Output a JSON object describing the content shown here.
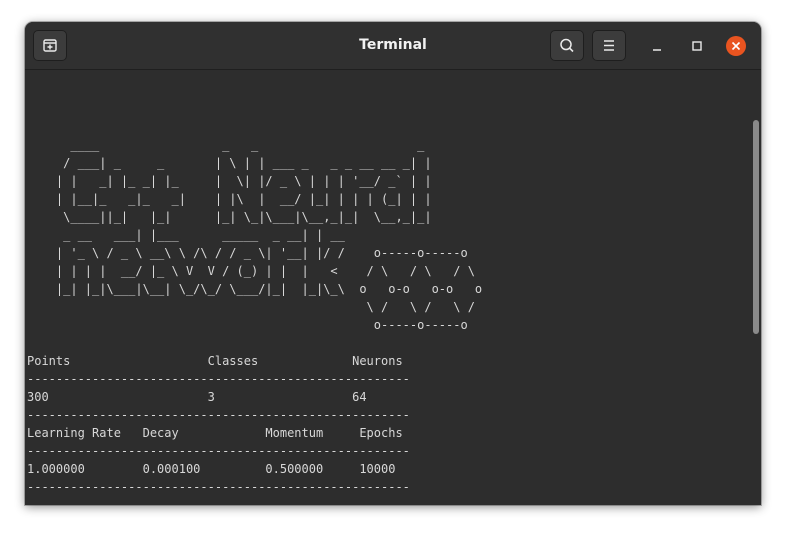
{
  "window": {
    "title": "Terminal",
    "accent_close": "#e95420",
    "background": "#2d2d2d"
  },
  "toolbar": {
    "new_tab_icon": "new-tab-icon",
    "search_icon": "search-icon",
    "menu_icon": "hamburger-menu-icon",
    "minimize_icon": "minimize-icon",
    "maximize_icon": "maximize-icon",
    "close_icon": "close-icon"
  },
  "terminal": {
    "banner": [
      "                                                        ",
      "                                                        ",
      "                                                        ",
      "      ____                 _   _                      _ ",
      "     / ___| _     _       | \\ | | ___ _   _ _ __ __ _| |",
      "    | |   _| |_ _| |_     |  \\| |/ _ \\ | | | '__/ _` | |",
      "    | |__|_   _|_   _|    | |\\  |  __/ |_| | | | (_| | |",
      "     \\____||_|   |_|      |_| \\_|\\___|\\__,_|_|  \\__,_|_|",
      "     _ __   ___| |___      _____  _ __| | __",
      "    | '_ \\ / _ \\ __\\ \\ /\\ / / _ \\| '__| |/ /    o-----o-----o",
      "    | | | |  __/ |_ \\ V  V / (_) | |  |   <    / \\   / \\   / \\",
      "    |_| |_|\\___|\\__| \\_/\\_/ \\___/|_|  |_|\\_\\  o   o-o   o-o   o",
      "                                               \\ /   \\ /   \\ /",
      "                                                o-----o-----o"
    ],
    "table": [
      "Points                   Classes             Neurons",
      "-----------------------------------------------------",
      "300                      3                   64",
      "-----------------------------------------------------",
      "Learning Rate   Decay            Momentum     Epochs",
      "-----------------------------------------------------",
      "1.000000        0.000100         0.500000     10000",
      "-----------------------------------------------------",
      "-----------------------------------------------------"
    ]
  }
}
